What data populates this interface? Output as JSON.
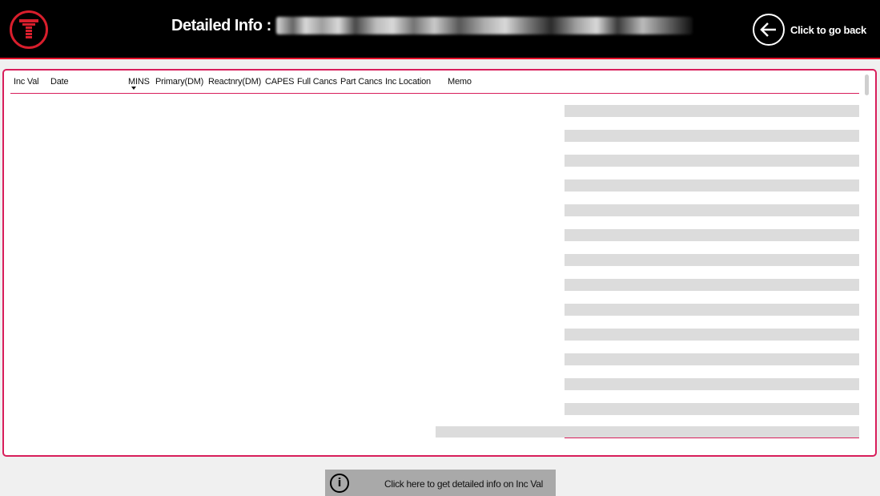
{
  "header": {
    "title": "Detailed Info :",
    "back_label": "Click to go back"
  },
  "table": {
    "columns": [
      {
        "label": "Inc Val"
      },
      {
        "label": "Date"
      },
      {
        "label": "MINS",
        "sorted": "descending"
      },
      {
        "label": "Primary(DM)"
      },
      {
        "label": "Reactnry(DM)"
      },
      {
        "label": "CAPES"
      },
      {
        "label": "Full Cancs"
      },
      {
        "label": "Part Cancs"
      },
      {
        "label": "Inc Location"
      },
      {
        "label": "Memo"
      }
    ]
  },
  "footer": {
    "info_button_label": "Click here to get detailed info on Inc Val",
    "info_icon": "info-icon"
  },
  "colors": {
    "accent": "#d81e5b",
    "brand_red": "#d81e2c",
    "header_bg": "#000000",
    "stripe": "#dcdcdc",
    "button_bg": "#a9a9a9"
  }
}
